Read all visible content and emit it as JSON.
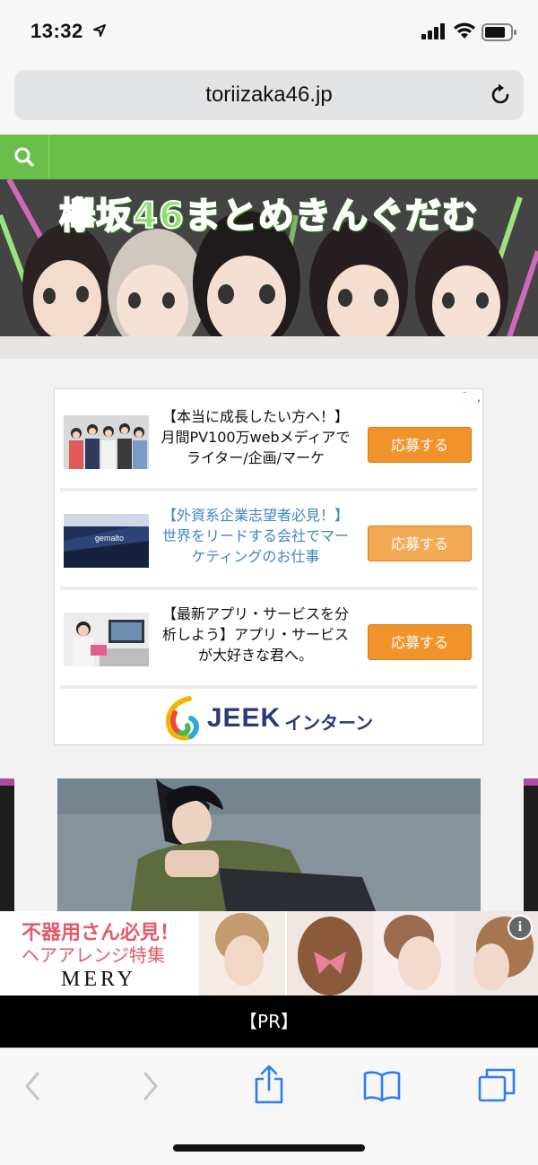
{
  "status": {
    "time": "13:32"
  },
  "browser": {
    "url": "toriizaka46.jp"
  },
  "banner": {
    "title": "欅坂46まとめきんぐだむ"
  },
  "ads": [
    {
      "text": "【本当に成長したい方へ！】月間PV100万webメディアでライター/企画/マーケ",
      "button": "応募する",
      "style": "normal"
    },
    {
      "text": "【外資系企業志望者必見！】世界をリードする会社でマーケティングのお仕事",
      "button": "応募する",
      "style": "link"
    },
    {
      "text": "【最新アプリ・サービスを分析しよう】アプリ・サービスが大好きな君へ。",
      "button": "応募する",
      "style": "normal"
    }
  ],
  "ad_brand": {
    "name": "JEEK",
    "suffix": "インターン"
  },
  "ad_thumb2_logo": "gemalto",
  "mery_ad": {
    "line1": "不器用さん必見！",
    "line2": "ヘアアレンジ特集",
    "logo": "MERY",
    "info_icon": "i"
  },
  "pr_label": "【PR】",
  "colors": {
    "green": "#6abf4b",
    "apply": "#f0932b",
    "link": "#3e86c6",
    "jeek": "#2a3a78",
    "mery_pink": "#e35a6b"
  },
  "icons": [
    "location-arrow-icon",
    "signal-icon",
    "wifi-icon",
    "battery-icon",
    "reload-icon",
    "search-icon",
    "adchoices-icon",
    "back-icon",
    "forward-icon",
    "share-icon",
    "bookmarks-icon",
    "tabs-icon"
  ]
}
